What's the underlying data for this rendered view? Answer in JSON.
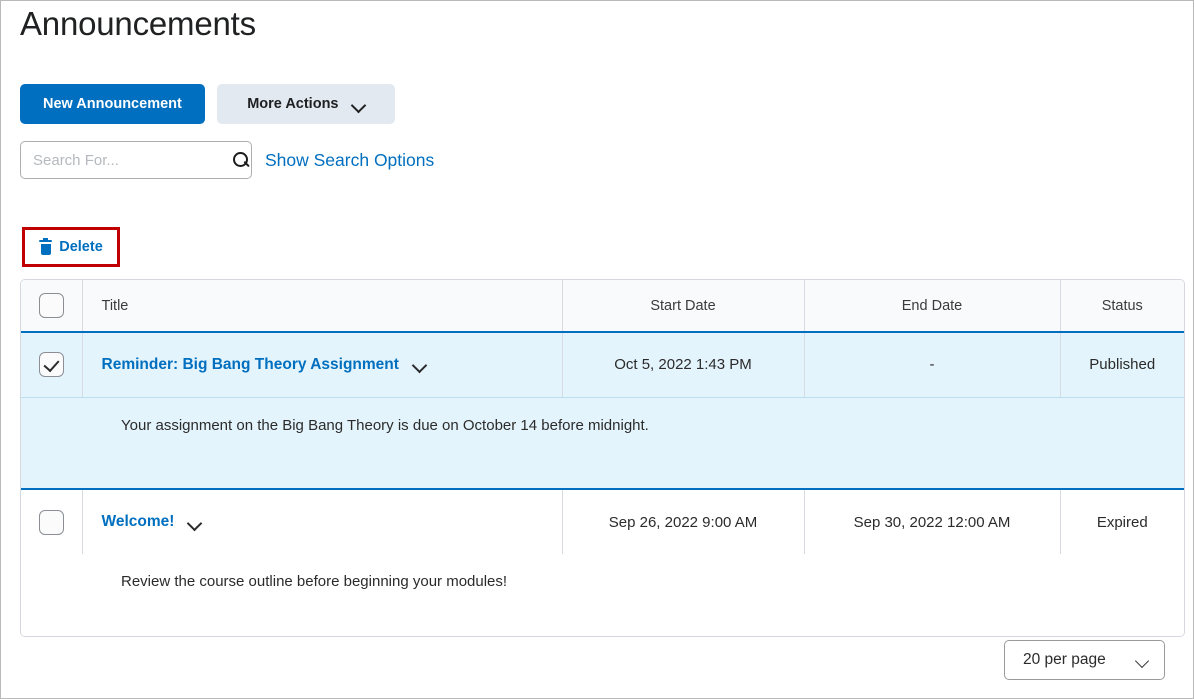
{
  "page": {
    "title": "Announcements"
  },
  "toolbar": {
    "new_announcement_label": "New Announcement",
    "more_actions_label": "More Actions"
  },
  "search": {
    "placeholder": "Search For...",
    "value": "",
    "search_icon": "search-icon",
    "show_options_label": "Show Search Options"
  },
  "bulk_actions": {
    "delete_label": "Delete",
    "delete_icon": "trash-icon",
    "highlight_color": "#c00000"
  },
  "table": {
    "columns": [
      {
        "key": "check",
        "label": ""
      },
      {
        "key": "title",
        "label": "Title"
      },
      {
        "key": "start",
        "label": "Start Date"
      },
      {
        "key": "end",
        "label": "End Date"
      },
      {
        "key": "status",
        "label": "Status"
      }
    ],
    "select_all_checked": false,
    "rows": [
      {
        "checked": true,
        "title": "Reminder: Big Bang Theory Assignment",
        "start_date": "Oct 5, 2022 1:43 PM",
        "end_date": "-",
        "status": "Published",
        "body": "Your assignment on the Big Bang Theory is due on October 14 before midnight."
      },
      {
        "checked": false,
        "title": "Welcome!",
        "start_date": "Sep 26, 2022 9:00 AM",
        "end_date": "Sep 30, 2022 12:00 AM",
        "status": "Expired",
        "body": "Review the course outline before beginning your modules!"
      }
    ]
  },
  "pager": {
    "per_page_label": "20 per page"
  },
  "colors": {
    "accent": "#006fbf",
    "selected_row_bg": "#e4f4fc",
    "annotation_red": "#c00000"
  }
}
